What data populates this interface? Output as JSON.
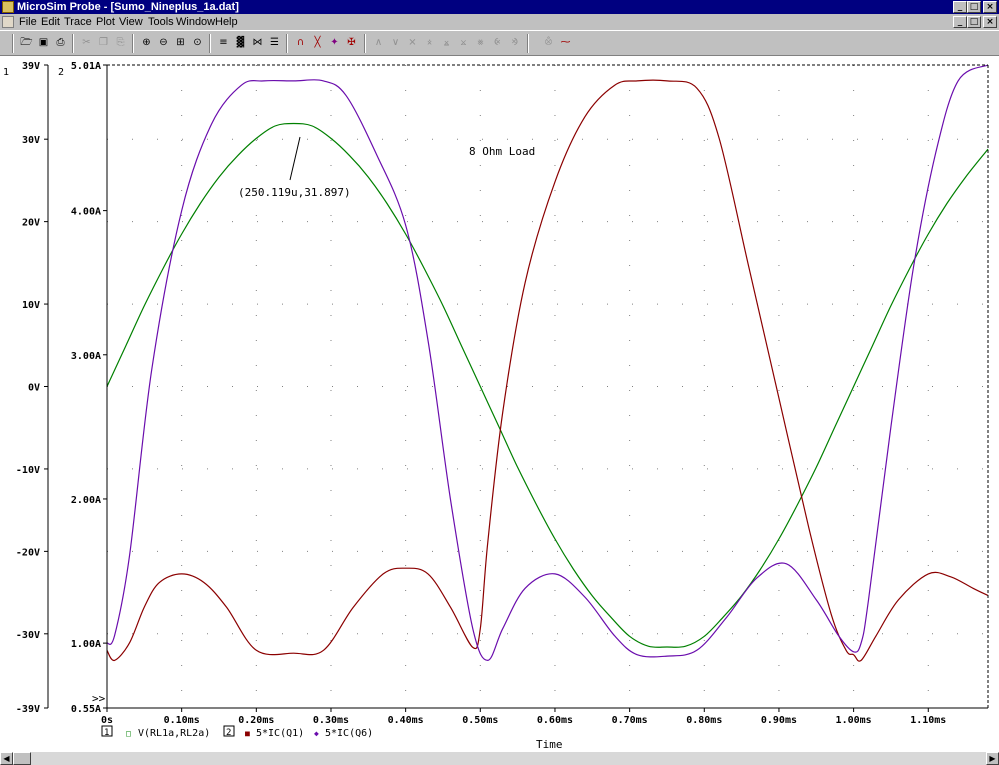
{
  "window": {
    "title": "MicroSim Probe - [Sumo_Nineplus_1a.dat]",
    "controls": [
      "_",
      "□",
      "×"
    ],
    "doc_controls": [
      "_",
      "□",
      "×"
    ]
  },
  "menu": [
    "File",
    "Edit",
    "Trace",
    "Plot",
    "View",
    "Tools",
    "Window",
    "Help"
  ],
  "toolbar_icons": [
    "open-icon",
    "save-icon",
    "print-icon",
    "cut-icon",
    "copy-icon",
    "paste-icon",
    "zoom-in-icon",
    "zoom-out-icon",
    "zoom-area-icon",
    "zoom-fit-icon",
    "add-trace-icon",
    "fourier-icon",
    "eye-diagram-icon",
    "text-label-icon",
    "cursor-peak-icon",
    "cursor-trough-icon",
    "cursor-slope-icon",
    "cursor-min-icon",
    "cursor-max-icon",
    "cursor-point-icon",
    "cursor-search-icon",
    "cursor-next-icon",
    "cursor-prev-icon",
    "cursor-label-icon",
    "mark-label-icon",
    "mark-data-icon",
    "display-cursor-icon",
    "toggle-cursor-icon"
  ],
  "colors": {
    "voltage": "#008000",
    "ic_q1": "#8b0000",
    "ic_q6": "#6a0dad",
    "axis": "#000000",
    "grid": "#808080"
  },
  "chart_data": {
    "type": "line",
    "annotation_text": "8 Ohm Load",
    "cursor_label": "(250.119u,31.897)",
    "y1_axis_id": "1",
    "y2_axis_id": "2",
    "y1_ticks": [
      "39V",
      "30V",
      "20V",
      "10V",
      "0V",
      "-10V",
      "-20V",
      "-30V",
      "-39V"
    ],
    "y1_tick_values": [
      39,
      30,
      20,
      10,
      0,
      -10,
      -20,
      -30,
      -39
    ],
    "y1_range": [
      -39,
      39
    ],
    "y2_ticks": [
      "5.01A",
      "4.00A",
      "3.00A",
      "2.00A",
      "1.00A",
      "0.55A"
    ],
    "y2_tick_values": [
      5.01,
      4.0,
      3.0,
      2.0,
      1.0,
      0.55
    ],
    "y2_range": [
      0.55,
      5.01
    ],
    "x_ticks": [
      "0s",
      "0.10ms",
      "0.20ms",
      "0.30ms",
      "0.40ms",
      "0.50ms",
      "0.60ms",
      "0.70ms",
      "0.80ms",
      "0.90ms",
      "1.00ms",
      "1.10ms"
    ],
    "x_range": [
      0,
      1.18
    ],
    "xlabel": "Time",
    "axis_marker": ">>",
    "legend": [
      {
        "axis_box": "1",
        "marker": "□",
        "name": "V(RL1a,RL2a)"
      },
      {
        "axis_box": "2",
        "marker": "■",
        "name": "5*IC(Q1)"
      },
      {
        "marker": "◆",
        "name": "5*IC(Q6)"
      }
    ],
    "series": [
      {
        "name": "V(RL1a,RL2a)",
        "axis": "y1",
        "x": [
          0,
          0.025,
          0.05,
          0.075,
          0.1,
          0.125,
          0.15,
          0.175,
          0.2,
          0.225,
          0.25,
          0.275,
          0.3,
          0.325,
          0.35,
          0.375,
          0.4,
          0.425,
          0.45,
          0.475,
          0.5,
          0.525,
          0.55,
          0.575,
          0.6,
          0.625,
          0.65,
          0.675,
          0.7,
          0.725,
          0.75,
          0.775,
          0.8,
          0.825,
          0.85,
          0.875,
          0.9,
          0.925,
          0.95,
          0.975,
          1.0,
          1.025,
          1.05,
          1.075,
          1.1,
          1.125,
          1.15,
          1.18
        ],
        "values": [
          0,
          4.9,
          9.8,
          14.3,
          18.5,
          22.2,
          25.4,
          28.0,
          30.1,
          31.6,
          31.9,
          31.6,
          30.1,
          28.0,
          25.4,
          22.2,
          18.5,
          14.3,
          9.8,
          4.9,
          0,
          -4.9,
          -9.8,
          -14.3,
          -18.5,
          -22.2,
          -25.4,
          -28.0,
          -30.3,
          -31.5,
          -31.6,
          -31.5,
          -30.3,
          -28.0,
          -25.4,
          -22.2,
          -18.5,
          -14.3,
          -9.8,
          -4.9,
          0,
          4.9,
          9.8,
          14.3,
          18.5,
          22.2,
          25.4,
          28.8
        ]
      },
      {
        "name": "5*IC(Q1)",
        "axis": "y2",
        "x": [
          0,
          0.01,
          0.03,
          0.05,
          0.07,
          0.1,
          0.13,
          0.16,
          0.2,
          0.25,
          0.29,
          0.33,
          0.37,
          0.4,
          0.43,
          0.46,
          0.49,
          0.5,
          0.51,
          0.53,
          0.56,
          0.6,
          0.64,
          0.68,
          0.71,
          0.75,
          0.79,
          0.82,
          0.86,
          0.9,
          0.94,
          0.97,
          0.99,
          1.0,
          1.01,
          1.03,
          1.06,
          1.1,
          1.13,
          1.16,
          1.18
        ],
        "values": [
          0.95,
          0.88,
          1.0,
          1.25,
          1.42,
          1.48,
          1.42,
          1.25,
          0.95,
          0.93,
          0.95,
          1.25,
          1.48,
          1.52,
          1.48,
          1.25,
          0.97,
          1.1,
          1.7,
          2.6,
          3.5,
          4.2,
          4.65,
          4.87,
          4.9,
          4.9,
          4.85,
          4.5,
          3.6,
          2.7,
          1.8,
          1.2,
          0.95,
          0.92,
          0.88,
          1.05,
          1.3,
          1.48,
          1.46,
          1.38,
          1.33
        ]
      },
      {
        "name": "5*IC(Q6)",
        "axis": "y2",
        "x": [
          0,
          0.01,
          0.03,
          0.06,
          0.1,
          0.14,
          0.18,
          0.21,
          0.25,
          0.29,
          0.32,
          0.36,
          0.4,
          0.43,
          0.46,
          0.49,
          0.51,
          0.53,
          0.56,
          0.6,
          0.64,
          0.68,
          0.71,
          0.75,
          0.79,
          0.83,
          0.87,
          0.91,
          0.95,
          0.98,
          1.0,
          1.01,
          1.02,
          1.05,
          1.08,
          1.11,
          1.14,
          1.18
        ],
        "values": [
          1.0,
          1.05,
          1.6,
          2.9,
          4.0,
          4.6,
          4.87,
          4.9,
          4.9,
          4.9,
          4.8,
          4.4,
          3.9,
          3.1,
          2.0,
          1.1,
          0.88,
          1.1,
          1.38,
          1.48,
          1.32,
          1.05,
          0.92,
          0.91,
          0.95,
          1.18,
          1.45,
          1.55,
          1.3,
          1.05,
          0.94,
          1.0,
          1.3,
          2.5,
          3.6,
          4.4,
          4.9,
          5.01
        ]
      }
    ]
  }
}
